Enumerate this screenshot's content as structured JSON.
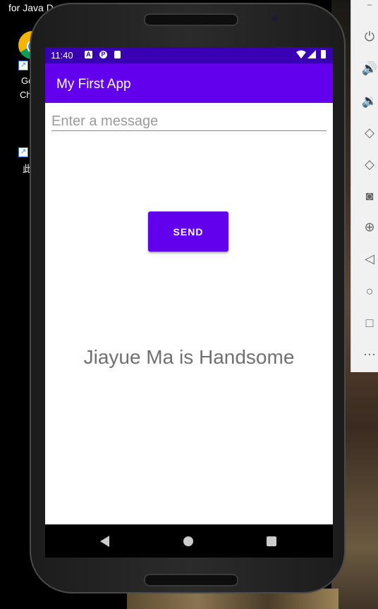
{
  "desktop": {
    "top_text": "for Java D",
    "icon1_label_line1": "Go",
    "icon1_label_line2": "Ch",
    "icon2_label": "此"
  },
  "status_bar": {
    "time": "11:40",
    "left_icons": [
      "a-notification-icon",
      "p-notification-icon",
      "sd-card-icon"
    ],
    "right_icons": [
      "wifi-icon",
      "signal-icon",
      "battery-icon"
    ]
  },
  "app_bar": {
    "title": "My First App"
  },
  "main": {
    "message_placeholder": "Enter a message",
    "message_value": "",
    "send_label": "SEND",
    "display_text": "Jiayue Ma is Handsome"
  },
  "emulator_toolbar": {
    "items": [
      "power-icon",
      "volume-up-icon",
      "volume-down-icon",
      "rotate-left-icon",
      "rotate-right-icon",
      "camera-icon",
      "zoom-icon",
      "back-icon",
      "home-icon",
      "overview-icon",
      "more-icon"
    ]
  },
  "nav_bar": {
    "buttons": [
      "back-icon",
      "home-icon",
      "recents-icon"
    ]
  },
  "colors": {
    "primary": "#6200ee",
    "primary_dark": "#3700b3",
    "text_secondary": "#707070"
  }
}
